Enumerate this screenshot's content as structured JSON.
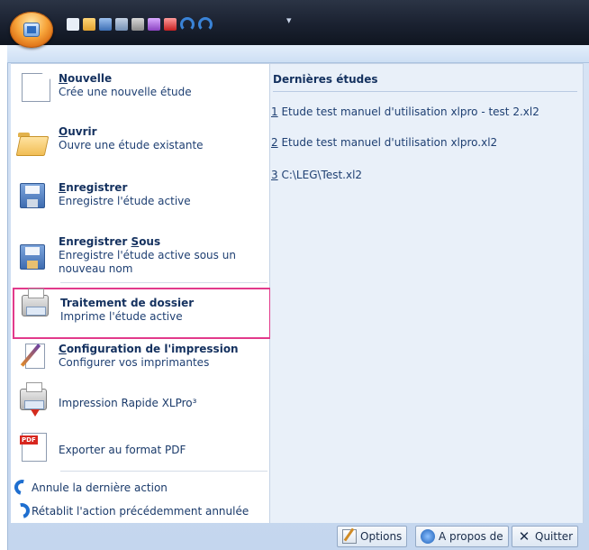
{
  "window": {
    "quick_access_more": "▾"
  },
  "menu": {
    "items": [
      {
        "title_pre": "",
        "title_key": "N",
        "title_rest": "ouvelle",
        "desc": "Crée une nouvelle étude",
        "icon": "new-document-icon"
      },
      {
        "title_pre": "",
        "title_key": "O",
        "title_rest": "uvrir",
        "desc": "Ouvre une étude existante",
        "icon": "open-folder-icon"
      },
      {
        "title_pre": "",
        "title_key": "E",
        "title_rest": "nregistrer",
        "desc": "Enregistre l'étude active",
        "icon": "save-floppy-icon"
      },
      {
        "title_pre": "Enregistrer ",
        "title_key": "S",
        "title_rest": "ous",
        "desc_line1": "Enregistre l'étude active sous un",
        "desc_line2": "nouveau nom",
        "icon": "save-as-icon"
      },
      {
        "title_pre": "",
        "title_key": "",
        "title_rest": "Traitement de dossier",
        "desc": "Imprime l'étude active",
        "icon": "printer-icon"
      },
      {
        "title_pre": "",
        "title_key": "C",
        "title_rest": "onfiguration de l'impression",
        "desc": "Configurer vos imprimantes",
        "icon": "print-setup-icon"
      },
      {
        "label": "Impression Rapide XLPro³",
        "icon": "quick-print-icon"
      },
      {
        "label": "Exporter au format PDF",
        "icon": "pdf-export-icon"
      }
    ],
    "undo_label": "Annule la dernière action",
    "redo_label": "Rétablit l'action précédemment annulée"
  },
  "recent": {
    "title": "Dernières études",
    "files": [
      {
        "num": "1",
        "name": " Etude test manuel d'utilisation xlpro - test 2.xl2"
      },
      {
        "num": "2",
        "name": " Etude test manuel d'utilisation xlpro.xl2"
      },
      {
        "num": "3",
        "name": " C:\\LEG\\Test.xl2"
      }
    ]
  },
  "footer": {
    "options_label": "Options",
    "about_label": "A propos de",
    "quit_label": "Quitter"
  },
  "colors": {
    "highlight_border": "#e23a8b",
    "menu_text": "#14315f",
    "panel_bg": "#e9f0f9"
  }
}
